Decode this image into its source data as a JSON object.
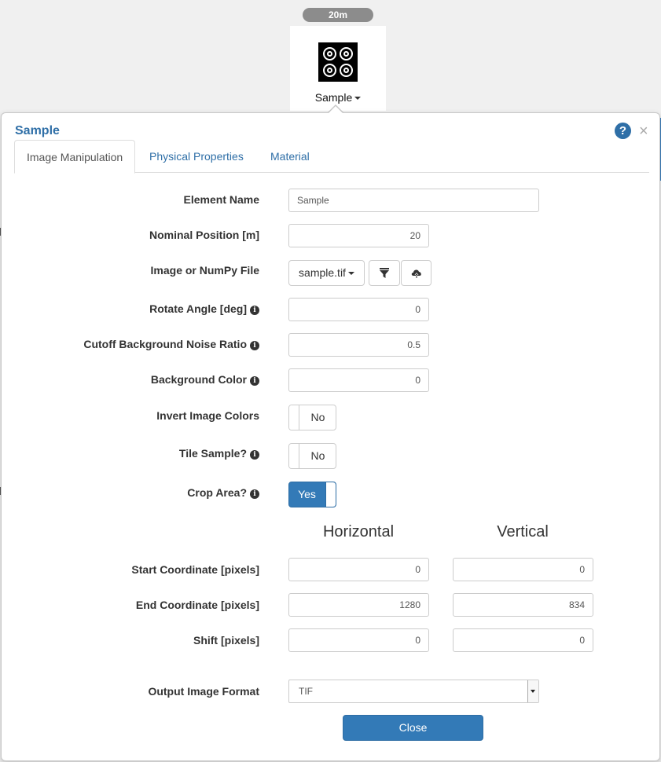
{
  "element": {
    "distance_badge": "20m",
    "label": "Sample"
  },
  "popover": {
    "title": "Sample",
    "help_icon_glyph": "?",
    "close_glyph": "×"
  },
  "tabs": [
    {
      "label": "Image Manipulation",
      "active": true
    },
    {
      "label": "Physical Properties",
      "active": false
    },
    {
      "label": "Material",
      "active": false
    }
  ],
  "form": {
    "element_name": {
      "label": "Element Name",
      "value": "Sample"
    },
    "nominal_position": {
      "label": "Nominal Position [m]",
      "value": "20"
    },
    "image_file": {
      "label": "Image or NumPy File",
      "value": "sample.tif"
    },
    "rotate_angle": {
      "label": "Rotate Angle [deg]",
      "value": "0"
    },
    "cutoff_noise": {
      "label": "Cutoff Background Noise Ratio",
      "value": "0.5"
    },
    "background_color": {
      "label": "Background Color",
      "value": "0"
    },
    "invert_colors": {
      "label": "Invert Image Colors",
      "value": "No"
    },
    "tile_sample": {
      "label": "Tile Sample?",
      "value": "No"
    },
    "crop_area": {
      "label": "Crop Area?",
      "value": "Yes"
    },
    "columns": {
      "horizontal": "Horizontal",
      "vertical": "Vertical"
    },
    "start_coordinate": {
      "label": "Start Coordinate [pixels]",
      "horizontal": "0",
      "vertical": "0"
    },
    "end_coordinate": {
      "label": "End Coordinate [pixels]",
      "horizontal": "1280",
      "vertical": "834"
    },
    "shift": {
      "label": "Shift [pixels]",
      "horizontal": "0",
      "vertical": "0"
    },
    "output_format": {
      "label": "Output Image Format",
      "value": "TIF"
    }
  },
  "buttons": {
    "close": "Close"
  },
  "icons": {
    "element_icon": "sample-rings-icon",
    "filter": "filter-icon",
    "upload": "cloud-upload-icon",
    "info": "info-icon"
  },
  "colors": {
    "accent": "#337ab7",
    "title": "#2f6fa7",
    "badge": "#8c8c8c"
  }
}
